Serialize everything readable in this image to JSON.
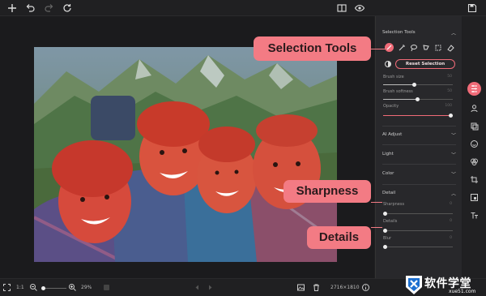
{
  "colors": {
    "accent": "#f06b78",
    "callout": "#f37b84",
    "panel": "#28282b",
    "canvas": "#1b1b1d"
  },
  "toolbar": {
    "icons": [
      "plus-icon",
      "undo-icon",
      "redo-icon",
      "reset-icon",
      "compare-icon",
      "eye-icon",
      "save-icon"
    ]
  },
  "panel": {
    "selection_tools_title": "Selection Tools",
    "reset_selection_label": "Reset Selection",
    "brush_size_label": "Brush size",
    "brush_size_value": "50",
    "brush_softness_label": "Brush softness",
    "brush_softness_value": "50",
    "opacity_label": "Opacity",
    "opacity_value": "100",
    "ai_adjust_label": "AI Adjust",
    "light_label": "Light",
    "color_label": "Color",
    "detail_label": "Detail",
    "sharpness_label": "Sharpness",
    "sharpness_value": "0",
    "details_label": "Details",
    "details_value": "0",
    "blur_label": "Blur",
    "blur_value": "0"
  },
  "callouts": {
    "selection_tools": "Selection Tools",
    "sharpness": "Sharpness",
    "details": "Details"
  },
  "bottombar": {
    "fit_label": "1:1",
    "zoom_value": "29%",
    "image_size": "2716×1810"
  },
  "watermark": {
    "brand": "软件学堂",
    "domain": "xue51.com"
  }
}
